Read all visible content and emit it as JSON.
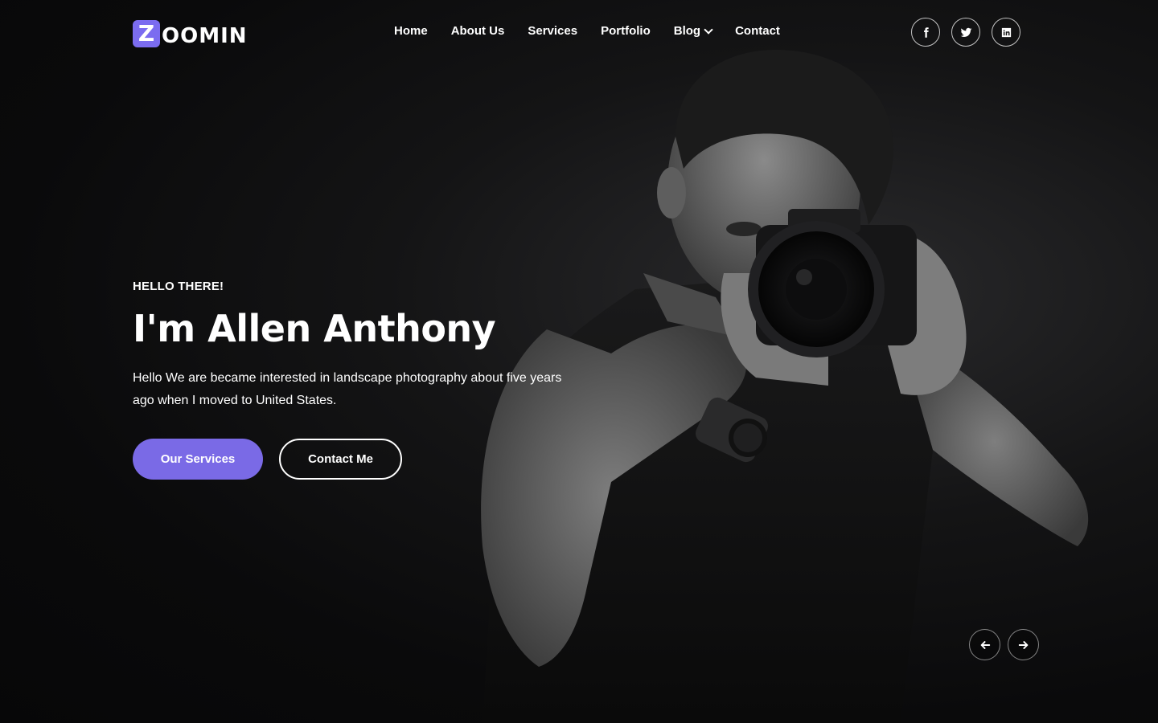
{
  "brand": {
    "logo_letter": "Z",
    "logo_rest": "OOMIN",
    "accent": "#7b6cf0"
  },
  "nav": {
    "items": [
      {
        "label": "Home"
      },
      {
        "label": "About Us"
      },
      {
        "label": "Services"
      },
      {
        "label": "Portfolio"
      },
      {
        "label": "Blog",
        "has_dropdown": true
      },
      {
        "label": "Contact"
      }
    ]
  },
  "social": {
    "icons": [
      "facebook-icon",
      "twitter-icon",
      "linkedin-icon"
    ]
  },
  "hero": {
    "eyebrow": "HELLO THERE!",
    "title": "I'm Allen Anthony",
    "description": "Hello We are became interested in landscape photography about five years ago when I moved to United States.",
    "primary_button": "Our Services",
    "secondary_button": "Contact Me",
    "primary_color": "#7a6ae6"
  },
  "slider": {
    "prev_icon": "arrow-left-icon",
    "next_icon": "arrow-right-icon"
  }
}
